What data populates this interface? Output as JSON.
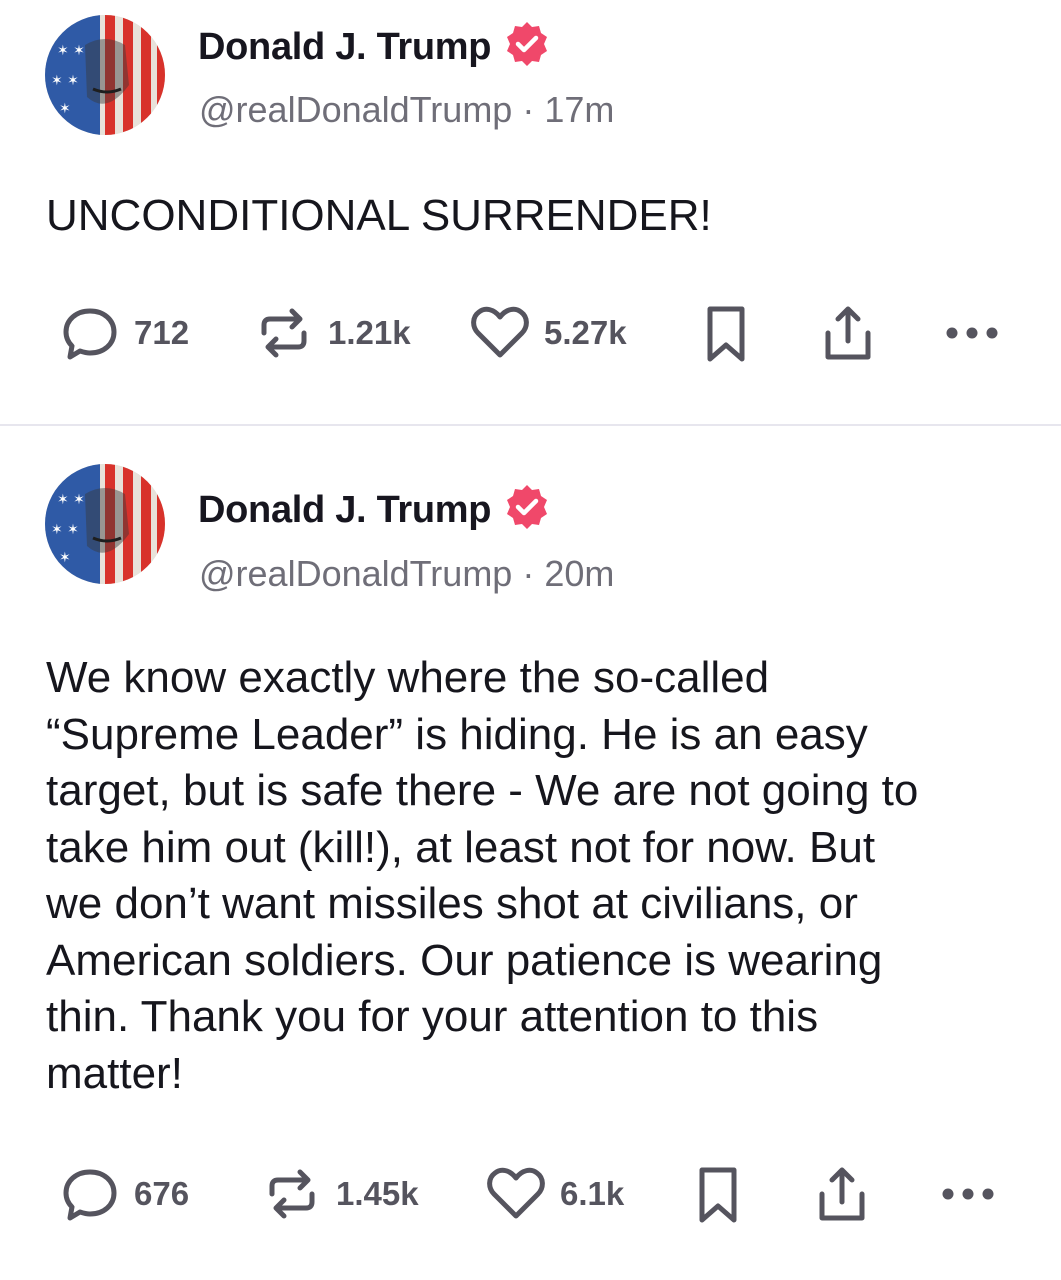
{
  "posts": [
    {
      "author_name": "Donald J. Trump",
      "handle": "@realDonaldTrump",
      "separator": "·",
      "time": "17m",
      "text": "UNCONDITIONAL SURRENDER!",
      "replies": "712",
      "reposts": "1.21k",
      "likes": "5.27k"
    },
    {
      "author_name": "Donald J. Trump",
      "handle": "@realDonaldTrump",
      "separator": "·",
      "time": "20m",
      "text": "We know exactly where the so-called\n“Supreme Leader” is hiding. He is an easy\ntarget, but is safe there - We are not going to\ntake him out (kill!), at least not for now. But\nwe don’t want missiles shot at civilians, or\nAmerican soldiers. Our patience is wearing\nthin. Thank you for your attention to this\nmatter!",
      "replies": "676",
      "reposts": "1.45k",
      "likes": "6.1k"
    }
  ],
  "icons": {
    "verified_badge": "verified-badge-icon",
    "reply": "reply-icon",
    "repost": "repost-icon",
    "like": "heart-icon",
    "bookmark": "bookmark-icon",
    "share": "share-icon",
    "more": "more-dots-icon"
  },
  "colors": {
    "verified": "#f0486a",
    "icon_gray": "#55545e",
    "text": "#16161d",
    "muted": "#6f6e78",
    "divider": "#e7e6ee"
  }
}
